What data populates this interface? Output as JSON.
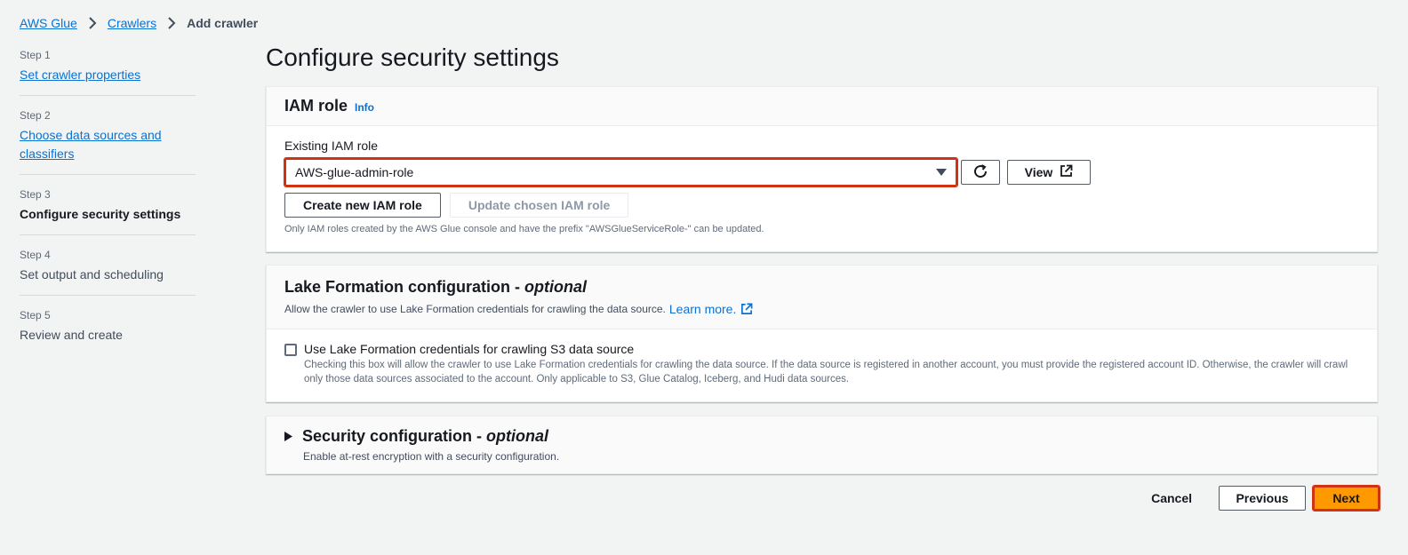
{
  "breadcrumb": {
    "items": [
      "AWS Glue",
      "Crawlers"
    ],
    "current": "Add crawler"
  },
  "steps": [
    {
      "num": "Step 1",
      "label": "Set crawler properties"
    },
    {
      "num": "Step 2",
      "label": "Choose data sources and classifiers"
    },
    {
      "num": "Step 3",
      "label": "Configure security settings"
    },
    {
      "num": "Step 4",
      "label": "Set output and scheduling"
    },
    {
      "num": "Step 5",
      "label": "Review and create"
    }
  ],
  "page_title": "Configure security settings",
  "iam": {
    "title": "IAM role",
    "info": "Info",
    "field_label": "Existing IAM role",
    "selected": "AWS-glue-admin-role",
    "view_label": "View",
    "create_label": "Create new IAM role",
    "update_label": "Update chosen IAM role",
    "hint": "Only IAM roles created by the AWS Glue console and have the prefix \"AWSGlueServiceRole-\" can be updated."
  },
  "lake": {
    "title": "Lake Formation configuration -",
    "title_optional": "optional",
    "desc": "Allow the crawler to use Lake Formation credentials for crawling the data source.",
    "learn_more": "Learn more.",
    "checkbox_label": "Use Lake Formation credentials for crawling S3 data source",
    "checkbox_desc": "Checking this box will allow the crawler to use Lake Formation credentials for crawling the data source. If the data source is registered in another account, you must provide the registered account ID. Otherwise, the crawler will crawl only those data sources associated to the account. Only applicable to S3, Glue Catalog, Iceberg, and Hudi data sources."
  },
  "security": {
    "title": "Security configuration -",
    "title_optional": "optional",
    "desc": "Enable at-rest encryption with a security configuration."
  },
  "footer": {
    "cancel": "Cancel",
    "previous": "Previous",
    "next": "Next"
  },
  "colors": {
    "link": "#0972d3",
    "primary": "#ff9900",
    "highlight": "#d13212"
  }
}
